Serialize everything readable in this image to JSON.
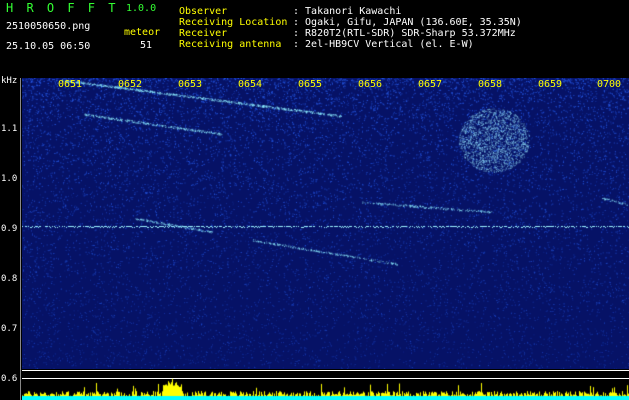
{
  "app": {
    "title": "H R O F F T",
    "version": "1.0.0",
    "filename": "2510050650.png",
    "datetime": "25.10.05 06:50",
    "meteor_label": "meteor",
    "meteor_count": "51"
  },
  "info": {
    "labels": [
      "Observer",
      "Receiving Location",
      "Receiver",
      "Receiving antenna"
    ],
    "values": [
      ": Takanori Kawachi",
      ": Ogaki, Gifu, JAPAN (136.60E, 35.35N)",
      ": R820T2(RTL-SDR) SDR-Sharp 53.372MHz",
      ": 2el-HB9CV Vertical (el. E-W)"
    ]
  },
  "spectrogram": {
    "unit": "kHz",
    "freq_ticks": [
      "1.1",
      "1.0",
      "0.9",
      "0.8",
      "0.7",
      "0.6"
    ],
    "time_ticks": [
      "0651",
      "0652",
      "0653",
      "0654",
      "0655",
      "0656",
      "0657",
      "0658",
      "0659",
      "0700"
    ]
  },
  "colors": {
    "background": "#061266",
    "noise": "#1e4fd6",
    "signal": "#7fe8ff",
    "carrier": "#9cf2ff",
    "level_bar": "#ffff00",
    "level_base": "#00ffff"
  }
}
